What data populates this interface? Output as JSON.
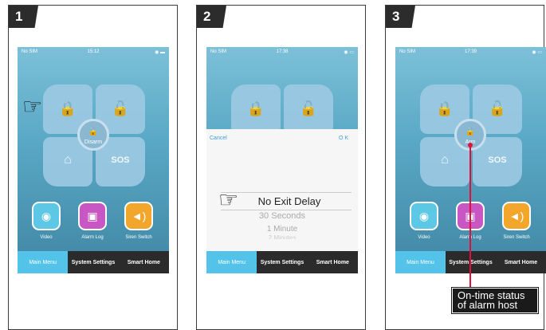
{
  "panels": [
    {
      "number": "1",
      "carrier": "No SIM",
      "time": "15:12",
      "center": "Disarm",
      "sos": "SOS"
    },
    {
      "number": "2",
      "carrier": "No SIM",
      "time": "17:38",
      "cancel": "Cancel",
      "ok": "O K",
      "options": [
        "No Exit Delay",
        "30 Seconds",
        "1 Minute",
        "2 Minutes"
      ]
    },
    {
      "number": "3",
      "carrier": "No SIM",
      "time": "17:39",
      "center": "Arm",
      "sos": "SOS"
    }
  ],
  "apps": {
    "video": "Video",
    "alarm_log": "Alarm Log",
    "siren": "Siren Switch"
  },
  "tabs": [
    "Main Menu",
    "System Settings",
    "Smart Home"
  ],
  "callout": {
    "line1": "On-time status",
    "line2": "of alarm host"
  },
  "colors": {
    "accent": "#53c3ea",
    "callout_line": "#e0103a",
    "video": "#5cc8e6",
    "alarm_log": "#c857c4",
    "siren": "#f2a72c"
  }
}
